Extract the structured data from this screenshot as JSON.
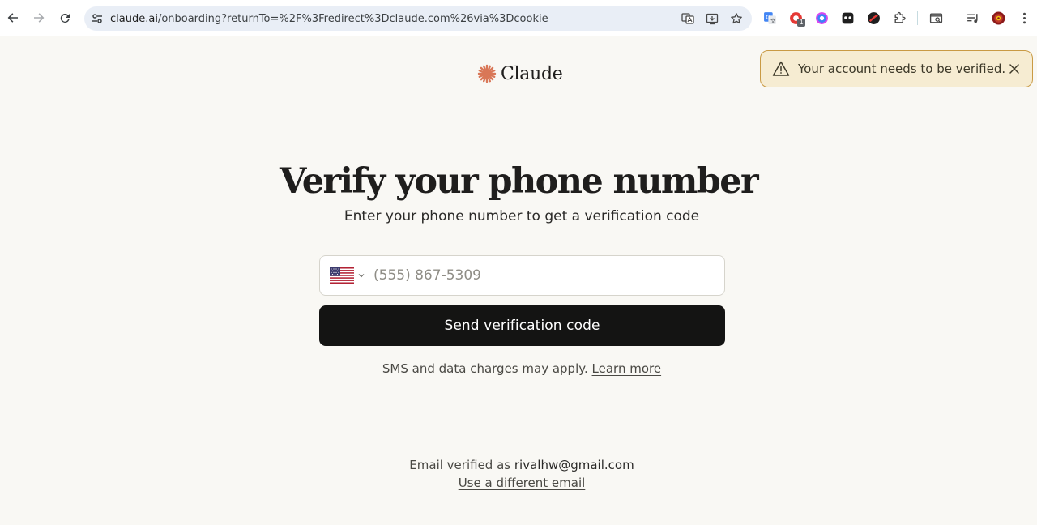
{
  "browser": {
    "url_host": "claude.ai",
    "url_rest": "/onboarding?returnTo=%2F%3Fredirect%3Dclaude.com%26via%3Dcookie",
    "extension_badge": "1"
  },
  "brand": {
    "name": "Claude",
    "accent": "#d97757"
  },
  "toast": {
    "message": "Your account needs to be verified."
  },
  "page": {
    "title": "Verify your phone number",
    "subtitle": "Enter your phone number to get a verification code"
  },
  "phone": {
    "country": "US",
    "placeholder": "(555) 867-5309",
    "value": ""
  },
  "send_button": "Send verification code",
  "disclaimer": {
    "text": "SMS and data charges may apply.",
    "link": "Learn more"
  },
  "email": {
    "prefix": "Email verified as",
    "address": "rivalhw@gmail.com",
    "change_link": "Use a different email"
  }
}
